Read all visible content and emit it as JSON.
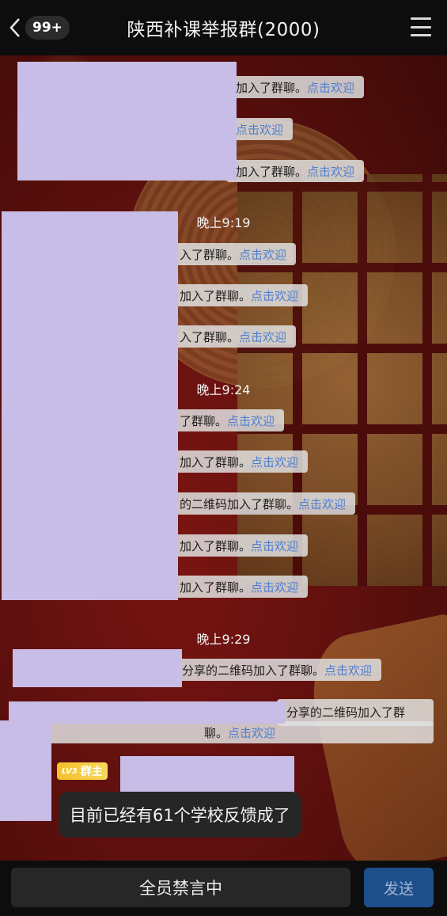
{
  "header": {
    "back_icon": "chevron-left-icon",
    "unread_badge": "99+",
    "title": "陕西补课举报群(2000)",
    "menu_icon": "hamburger-menu-icon"
  },
  "system_notices": [
    {
      "text": "加入了群聊。",
      "link": "点击欢迎"
    },
    {
      "text": "",
      "link": "点击欢迎"
    },
    {
      "text": "加入了群聊。",
      "link": "点击欢迎"
    },
    {
      "text": "入了群聊。",
      "link": "点击欢迎"
    },
    {
      "text": "加入了群聊。",
      "link": "点击欢迎"
    },
    {
      "text": "入了群聊。",
      "link": "点击欢迎"
    },
    {
      "text": "了群聊。",
      "link": "点击欢迎"
    },
    {
      "text": "加入了群聊。",
      "link": "点击欢迎"
    },
    {
      "text": "的二维码加入了群聊。",
      "link": "点击欢迎"
    },
    {
      "text": "加入了群聊。",
      "link": "点击欢迎"
    },
    {
      "text": "加入了群聊。",
      "link": "点击欢迎"
    },
    {
      "text": "分享的二维码加入了群聊。",
      "link": "点击欢迎"
    },
    {
      "line1": "分享的二维码加入了群",
      "line2": "聊。",
      "link": "点击欢迎"
    }
  ],
  "timestamps": [
    "晚上9:19",
    "晚上9:24",
    "晚上9:29"
  ],
  "message": {
    "role_level": "LV3",
    "role": "群主",
    "text": "目前已经有61个学校反馈成了"
  },
  "bottom": {
    "mute_status": "全员禁言中",
    "send_label": "发送"
  },
  "colors": {
    "link": "#4d7fd0",
    "redaction": "#c7bde6",
    "send_button": "#1f4f8a",
    "owner_badge": "#f4c12a"
  }
}
